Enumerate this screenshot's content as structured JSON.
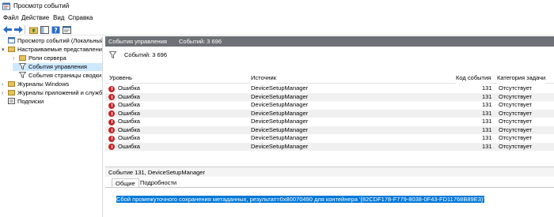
{
  "window": {
    "title": "Просмотр событий"
  },
  "menu": [
    "Файл",
    "Действие",
    "Вид",
    "Справка"
  ],
  "tree": [
    {
      "label": "Просмотр событий (Локальный)",
      "level": 0,
      "expander": "",
      "icon": "event-viewer-icon"
    },
    {
      "label": "Настраиваемые представления",
      "level": 1,
      "expander": "▾",
      "icon": "folder-icon"
    },
    {
      "label": "Роли сервера",
      "level": 2,
      "expander": "›",
      "icon": "folder-icon"
    },
    {
      "label": "События управления",
      "level": 2,
      "expander": "",
      "icon": "filter-icon",
      "selected": true
    },
    {
      "label": "События страницы сводки",
      "level": 2,
      "expander": "",
      "icon": "filter-icon"
    },
    {
      "label": "Журналы Windows",
      "level": 1,
      "expander": "›",
      "icon": "folder-icon"
    },
    {
      "label": "Журналы приложений и служб",
      "level": 1,
      "expander": "›",
      "icon": "folder-icon"
    },
    {
      "label": "Подписки",
      "level": 1,
      "expander": "",
      "icon": "subscription-icon"
    }
  ],
  "header": {
    "title": "События управления",
    "count": "Событий: 3 696"
  },
  "filter": {
    "count": "Событий: 3 696"
  },
  "columns": [
    "Уровень",
    "Источник",
    "Код события",
    "Категория задачи"
  ],
  "events": [
    {
      "level": "Ошибка",
      "source": "DeviceSetupManager",
      "code": "131",
      "category": "Отсутствует"
    },
    {
      "level": "Ошибка",
      "source": "DeviceSetupManager",
      "code": "131",
      "category": "Отсутствует"
    },
    {
      "level": "Ошибка",
      "source": "DeviceSetupManager",
      "code": "131",
      "category": "Отсутствует"
    },
    {
      "level": "Ошибка",
      "source": "DeviceSetupManager",
      "code": "131",
      "category": "Отсутствует"
    },
    {
      "level": "Ошибка",
      "source": "DeviceSetupManager",
      "code": "131",
      "category": "Отсутствует"
    },
    {
      "level": "Ошибка",
      "source": "DeviceSetupManager",
      "code": "131",
      "category": "Отсутствует"
    },
    {
      "level": "Ошибка",
      "source": "DeviceSetupManager",
      "code": "131",
      "category": "Отсутствует"
    },
    {
      "level": "Ошибка",
      "source": "DeviceSetupManager",
      "code": "131",
      "category": "Отсутствует"
    }
  ],
  "detail": {
    "title": "Событие 131, DeviceSetupManager",
    "tabs": [
      "Общие",
      "Подробности"
    ],
    "message": "Сбой промежуточного сохранения метаданных, результат=0x80070490 для контейнера '{82CDF178-F779-8038-0F43-FD11768B89E3}'"
  },
  "colors": {
    "header_bar": "#6d7175",
    "selection": "#cce8ff",
    "error": "#c62828",
    "highlight": "#0078d7"
  }
}
